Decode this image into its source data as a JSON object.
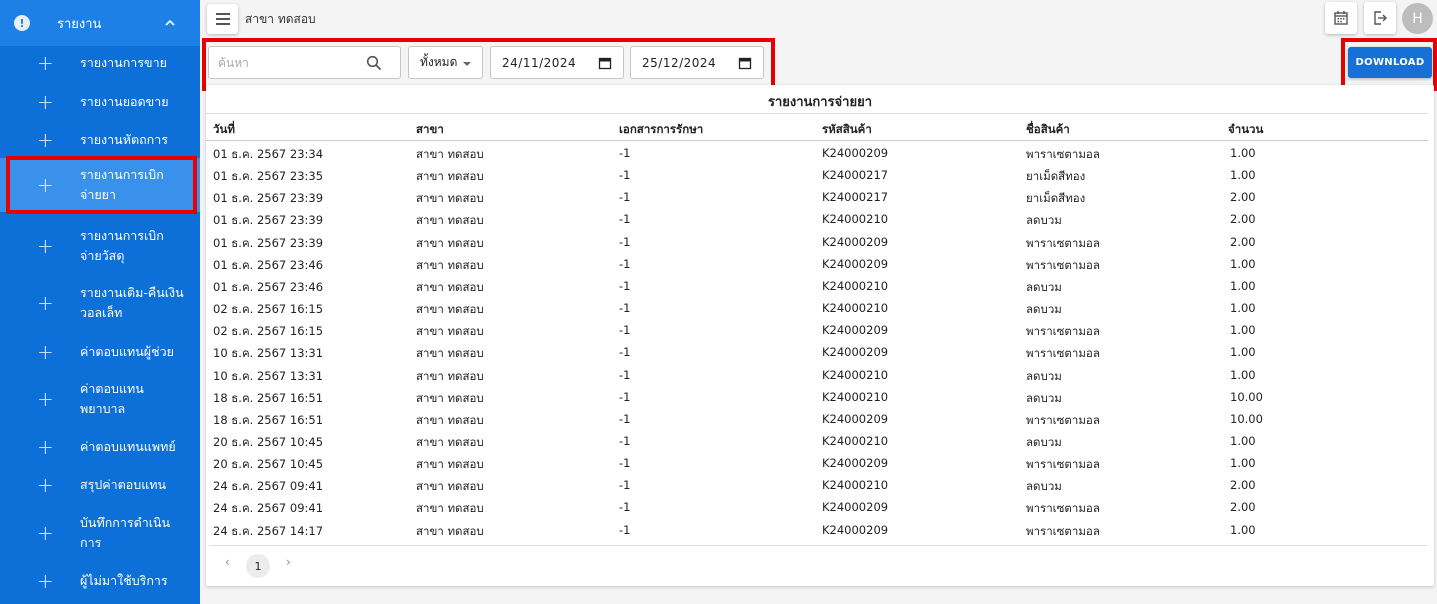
{
  "sidebar": {
    "header": "รายงาน",
    "items": [
      {
        "label": "รายงานการขาย"
      },
      {
        "label": "รายงานยอดขาย"
      },
      {
        "label": "รายงานหัตถการ"
      },
      {
        "label": "รายงานการเบิกจ่ายยา"
      },
      {
        "label": "รายงานการเบิกจ่ายวัสดุ"
      },
      {
        "label": "รายงานเติม-คืนเงินวอลเล็ท"
      },
      {
        "label": "ค่าตอบแทนผู้ช่วย"
      },
      {
        "label": "ค่าตอบแทนพยาบาล"
      },
      {
        "label": "ค่าตอบแทนแพทย์"
      },
      {
        "label": "สรุปค่าตอบแทน"
      },
      {
        "label": "บันทึกการดำเนินการ"
      },
      {
        "label": "ผู้ไม่มาใช้บริการ"
      }
    ]
  },
  "topbar": {
    "branch": "สาขา ทดสอบ",
    "avatar": "H"
  },
  "filters": {
    "search_placeholder": "ค้นหา",
    "select_value": "ทั้งหมด",
    "date_from": "24/11/2024",
    "date_to": "25/12/2024",
    "download_label": "DOWNLOAD"
  },
  "report": {
    "title": "รายงานการจ่ายยา",
    "columns": [
      "วันที่",
      "สาขา",
      "เอกสารการรักษา",
      "รหัสสินค้า",
      "ชื่อสินค้า",
      "จำนวน"
    ],
    "rows": [
      [
        "01 ธ.ค. 2567 23:34",
        "สาขา ทดสอบ",
        "-1",
        "K24000209",
        "พาราเซตามอล",
        "1.00"
      ],
      [
        "01 ธ.ค. 2567 23:35",
        "สาขา ทดสอบ",
        "-1",
        "K24000217",
        "ยาเม็ดสีทอง",
        "1.00"
      ],
      [
        "01 ธ.ค. 2567 23:39",
        "สาขา ทดสอบ",
        "-1",
        "K24000217",
        "ยาเม็ดสีทอง",
        "2.00"
      ],
      [
        "01 ธ.ค. 2567 23:39",
        "สาขา ทดสอบ",
        "-1",
        "K24000210",
        "ลดบวม",
        "2.00"
      ],
      [
        "01 ธ.ค. 2567 23:39",
        "สาขา ทดสอบ",
        "-1",
        "K24000209",
        "พาราเซตามอล",
        "2.00"
      ],
      [
        "01 ธ.ค. 2567 23:46",
        "สาขา ทดสอบ",
        "-1",
        "K24000209",
        "พาราเซตามอล",
        "1.00"
      ],
      [
        "01 ธ.ค. 2567 23:46",
        "สาขา ทดสอบ",
        "-1",
        "K24000210",
        "ลดบวม",
        "1.00"
      ],
      [
        "02 ธ.ค. 2567 16:15",
        "สาขา ทดสอบ",
        "-1",
        "K24000210",
        "ลดบวม",
        "1.00"
      ],
      [
        "02 ธ.ค. 2567 16:15",
        "สาขา ทดสอบ",
        "-1",
        "K24000209",
        "พาราเซตามอล",
        "1.00"
      ],
      [
        "10 ธ.ค. 2567 13:31",
        "สาขา ทดสอบ",
        "-1",
        "K24000209",
        "พาราเซตามอล",
        "1.00"
      ],
      [
        "10 ธ.ค. 2567 13:31",
        "สาขา ทดสอบ",
        "-1",
        "K24000210",
        "ลดบวม",
        "1.00"
      ],
      [
        "18 ธ.ค. 2567 16:51",
        "สาขา ทดสอบ",
        "-1",
        "K24000210",
        "ลดบวม",
        "10.00"
      ],
      [
        "18 ธ.ค. 2567 16:51",
        "สาขา ทดสอบ",
        "-1",
        "K24000209",
        "พาราเซตามอล",
        "10.00"
      ],
      [
        "20 ธ.ค. 2567 10:45",
        "สาขา ทดสอบ",
        "-1",
        "K24000210",
        "ลดบวม",
        "1.00"
      ],
      [
        "20 ธ.ค. 2567 10:45",
        "สาขา ทดสอบ",
        "-1",
        "K24000209",
        "พาราเซตามอล",
        "1.00"
      ],
      [
        "24 ธ.ค. 2567 09:41",
        "สาขา ทดสอบ",
        "-1",
        "K24000210",
        "ลดบวม",
        "2.00"
      ],
      [
        "24 ธ.ค. 2567 09:41",
        "สาขา ทดสอบ",
        "-1",
        "K24000209",
        "พาราเซตามอล",
        "2.00"
      ],
      [
        "24 ธ.ค. 2567 14:17",
        "สาขา ทดสอบ",
        "-1",
        "K24000209",
        "พาราเซตามอล",
        "1.00"
      ]
    ]
  },
  "pagination": {
    "current": "1",
    "prev": "‹",
    "next": "›"
  },
  "colors": {
    "sidebar": "#0d6fd8",
    "accent": "#1670d6",
    "highlight": "#e60000"
  }
}
